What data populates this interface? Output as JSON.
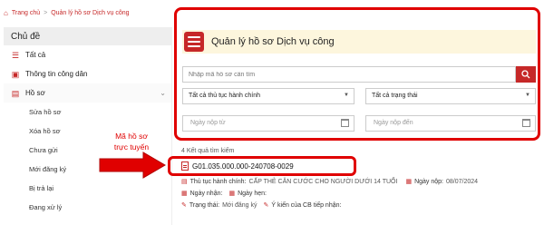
{
  "breadcrumb": {
    "home": "Trang chủ",
    "separator": ">",
    "current": "Quản lý hồ sơ Dịch vụ công"
  },
  "sidebar": {
    "title": "Chủ đề",
    "items": [
      {
        "label": "Tất cả",
        "icon": "list-icon"
      },
      {
        "label": "Thông tin công dân",
        "icon": "id-card-icon"
      },
      {
        "label": "Hồ sơ",
        "icon": "folder-icon"
      }
    ],
    "sub_items": [
      "Sửa hồ sơ",
      "Xóa hồ sơ",
      "Chưa gửi",
      "Mới đăng ký",
      "Bị trả lại",
      "Đang xử lý"
    ]
  },
  "panel": {
    "title": "Quản lý hồ sơ Dịch vụ công",
    "search_placeholder": "Nhập mã hồ sơ cần tìm",
    "procedure_select": "Tất cả thủ tục hành chính",
    "status_select": "Tất cả trạng thái",
    "date_from_placeholder": "Ngày nộp từ",
    "date_to_placeholder": "Ngày nộp đến"
  },
  "results": {
    "count_label": "4 Kết quả tìm kiếm",
    "record": {
      "code": "G01.035.000.000-240708-0029",
      "procedure_label": "Thủ tục hành chính:",
      "procedure_value": "CẤP THẺ CĂN CƯỚC CHO NGƯỜI DƯỚI 14 TUỔI",
      "submit_date_label": "Ngày nộp:",
      "submit_date_value": "08/07/2024",
      "received_label": "Ngày nhận:",
      "appointment_label": "Ngày hẹn:",
      "status_label": "Trạng thái:",
      "status_value": "Mới đăng ký",
      "feedback_label": "Ý kiến của CB tiếp nhận:"
    }
  },
  "annotation": {
    "text_line1": "Mã hồ sơ",
    "text_line2": "trực tuyến",
    "color": "#e00000"
  },
  "colors": {
    "accent": "#c62828",
    "highlight": "#e00000",
    "title_bar": "#fdf6dd"
  }
}
